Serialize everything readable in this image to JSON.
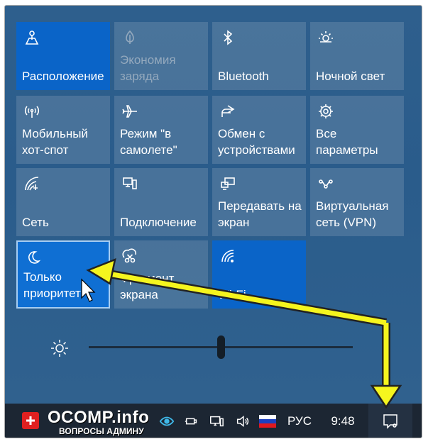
{
  "tiles": [
    {
      "name": "tile-location",
      "label": "Расположение",
      "icon": "location-icon"
    },
    {
      "name": "tile-battery-saver",
      "label": "Экономия\nзаряда",
      "icon": "battery-saver-icon"
    },
    {
      "name": "tile-bluetooth",
      "label": "Bluetooth",
      "icon": "bluetooth-icon"
    },
    {
      "name": "tile-night-light",
      "label": "Ночной свет",
      "icon": "night-light-icon"
    },
    {
      "name": "tile-mobile-hotspot",
      "label": "Мобильный\nхот-спот",
      "icon": "hotspot-icon"
    },
    {
      "name": "tile-airplane-mode",
      "label": "Режим \"в\nсамолете\"",
      "icon": "airplane-icon"
    },
    {
      "name": "tile-nearby-sharing",
      "label": "Обмен с\nустройствами",
      "icon": "share-icon"
    },
    {
      "name": "tile-all-settings",
      "label": "Все\nпараметры",
      "icon": "gear-icon"
    },
    {
      "name": "tile-network",
      "label": "Сеть",
      "icon": "network-icon"
    },
    {
      "name": "tile-connect",
      "label": "Подключение",
      "icon": "connect-icon"
    },
    {
      "name": "tile-project",
      "label": "Передавать на\nэкран",
      "icon": "project-icon"
    },
    {
      "name": "tile-vpn",
      "label": "Виртуальная\nсеть (VPN)",
      "icon": "vpn-icon"
    },
    {
      "name": "tile-focus-assist",
      "label": "Только\nприоритет",
      "icon": "moon-icon"
    },
    {
      "name": "tile-screen-snip",
      "label": "Фрагмент\nэкрана",
      "icon": "snip-icon"
    },
    {
      "name": "tile-wifi",
      "label": "Wi-Fi",
      "icon": "wifi-icon"
    }
  ],
  "brightness": {
    "icon": "brightness-icon",
    "level": 0.5
  },
  "taskbar": {
    "logo_text": "OCOMP.info",
    "logo_subtext": "ВОПРОСЫ АДМИНУ",
    "language": "РУС",
    "time": "9:48",
    "tray_icons": [
      "eye-icon",
      "power-plug-icon",
      "network-monitor-icon",
      "speaker-icon",
      "russia-flag-icon",
      "notification-icon"
    ]
  },
  "colors": {
    "panel_bg": "#2e5f8d",
    "tile_active": "#0a64c8",
    "tile_inactive": "#5a7fa2",
    "arrow_yellow": "#f5f51e"
  }
}
